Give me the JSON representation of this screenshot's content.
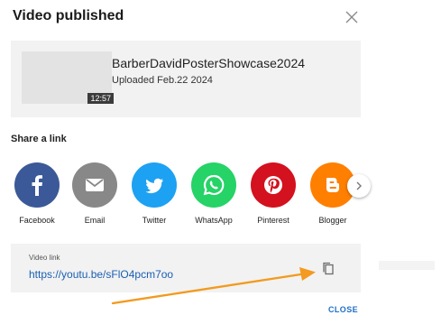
{
  "dialog": {
    "title": "Video published",
    "close_icon": "close-icon"
  },
  "video": {
    "title": "BarberDavidPosterShowcase2024",
    "uploaded": "Uploaded Feb.22 2024",
    "duration": "12:57"
  },
  "share": {
    "heading": "Share a link",
    "items": [
      {
        "label": "Facebook",
        "icon": "facebook-icon",
        "color": "#3b5998"
      },
      {
        "label": "Email",
        "icon": "email-icon",
        "color": "#888888"
      },
      {
        "label": "Twitter",
        "icon": "twitter-icon",
        "color": "#1da1f2"
      },
      {
        "label": "WhatsApp",
        "icon": "whatsapp-icon",
        "color": "#25d366"
      },
      {
        "label": "Pinterest",
        "icon": "pinterest-icon",
        "color": "#e60023"
      },
      {
        "label": "Blogger",
        "icon": "blogger-icon",
        "color": "#ff7f00"
      }
    ],
    "next_icon": "chevron-right-icon"
  },
  "link": {
    "label": "Video link",
    "url": "https://youtu.be/sFlO4pcm7oo",
    "copy_icon": "copy-icon"
  },
  "footer": {
    "close_label": "CLOSE"
  },
  "colors": {
    "accent": "#1e6fc9",
    "annotation_arrow": "#f39a1f"
  }
}
